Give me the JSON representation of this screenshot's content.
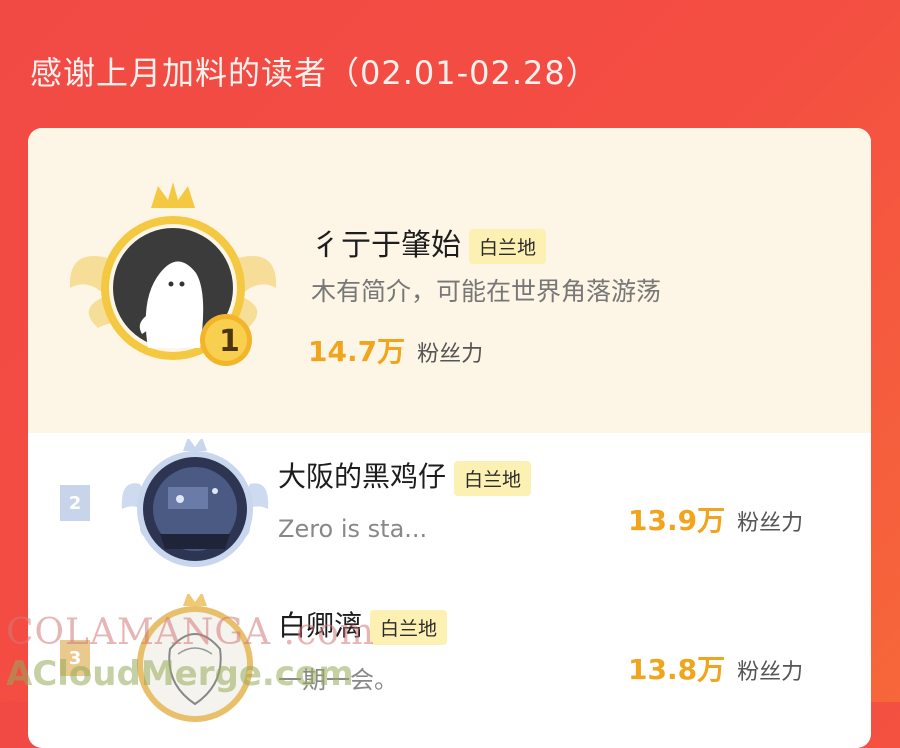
{
  "header": {
    "title": "感谢上月加料的读者（02.01-02.28）"
  },
  "colors": {
    "background": "#f44d42",
    "gold": "#f0a51d",
    "tag_bg": "#fdf0b3"
  },
  "ranking": [
    {
      "rank": "1",
      "name": "彳亍于肇始",
      "tag": "白兰地",
      "desc": "木有简介，可能在世界角落游荡",
      "score": "14.7万",
      "score_label": "粉丝力",
      "avatar_icon": "ghost-avatar-icon"
    },
    {
      "rank": "2",
      "name": "大阪的黑鸡仔",
      "tag": "白兰地",
      "desc": "Zero is sta...",
      "score": "13.9万",
      "score_label": "粉丝力",
      "avatar_icon": "anime-avatar-icon"
    },
    {
      "rank": "3",
      "name": "白卿漓",
      "tag": "白兰地",
      "desc": "一期一会。",
      "score": "13.8万",
      "score_label": "粉丝力",
      "avatar_icon": "sketch-avatar-icon"
    }
  ],
  "watermark": {
    "line1": "COLAMANGA .com",
    "line2": "ACloudMerge.com"
  }
}
